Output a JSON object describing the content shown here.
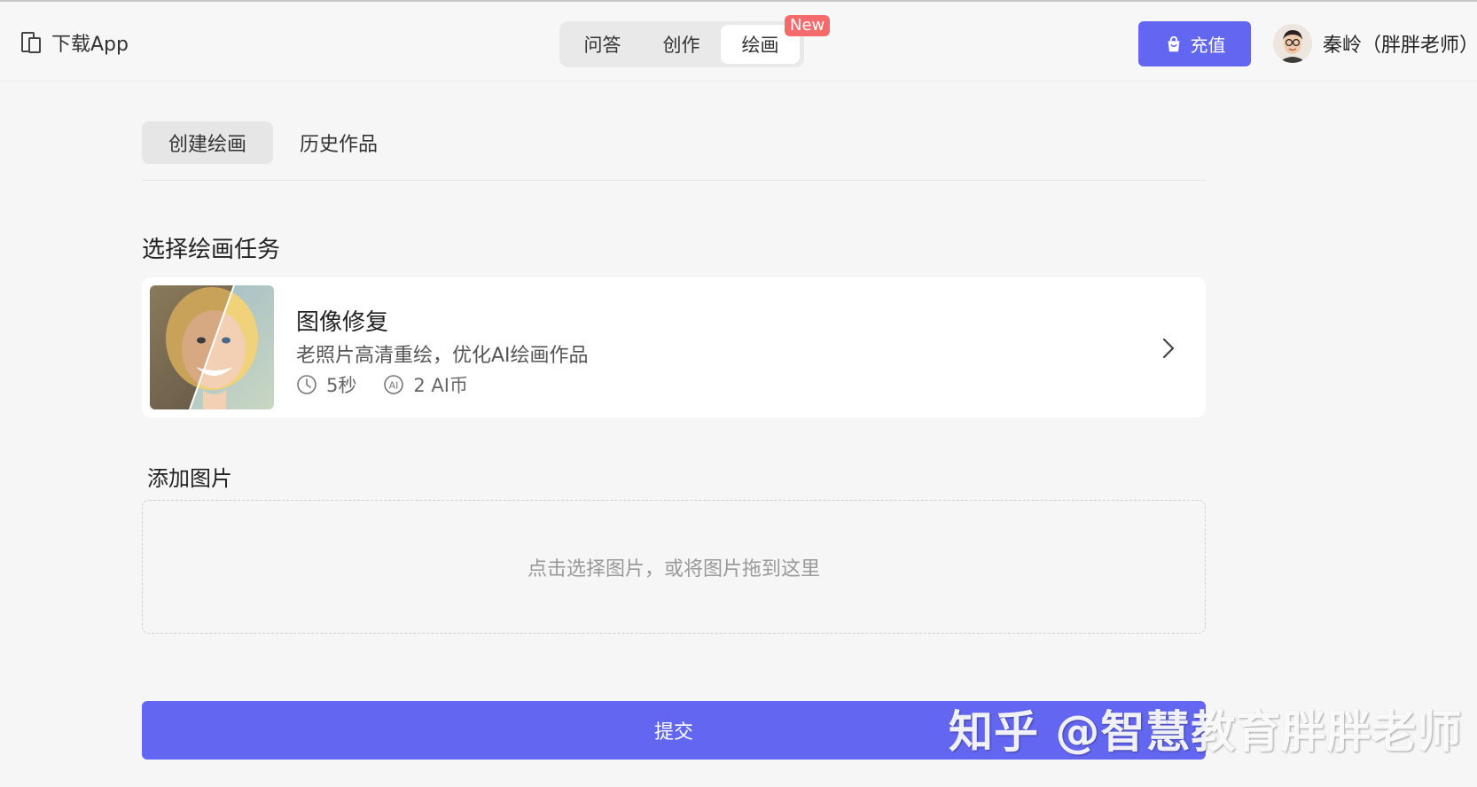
{
  "header": {
    "download_label": "下载App",
    "mode_tabs": [
      {
        "label": "问答"
      },
      {
        "label": "创作"
      },
      {
        "label": "绘画"
      }
    ],
    "active_mode": "绘画",
    "new_badge": "New",
    "recharge_label": "充值",
    "user_name": "秦岭（胖胖老师）"
  },
  "subtabs": [
    {
      "label": "创建绘画"
    },
    {
      "label": "历史作品"
    }
  ],
  "active_subtab": "创建绘画",
  "task_section": {
    "title": "选择绘画任务",
    "task": {
      "title": "图像修复",
      "description": "老照片高清重绘，优化AI绘画作品",
      "duration": "5秒",
      "cost": "2 AI币",
      "duration_icon": "clock-icon",
      "cost_icon": "ai-coin-icon"
    }
  },
  "upload_section": {
    "title": "添加图片",
    "hint": "点击选择图片，或将图片拖到这里"
  },
  "submit_label": "提交",
  "watermark": "知乎 @智慧教育胖胖老师",
  "colors": {
    "accent": "#6366f1",
    "badge": "#f56b6b",
    "background": "#f6f6f6"
  }
}
